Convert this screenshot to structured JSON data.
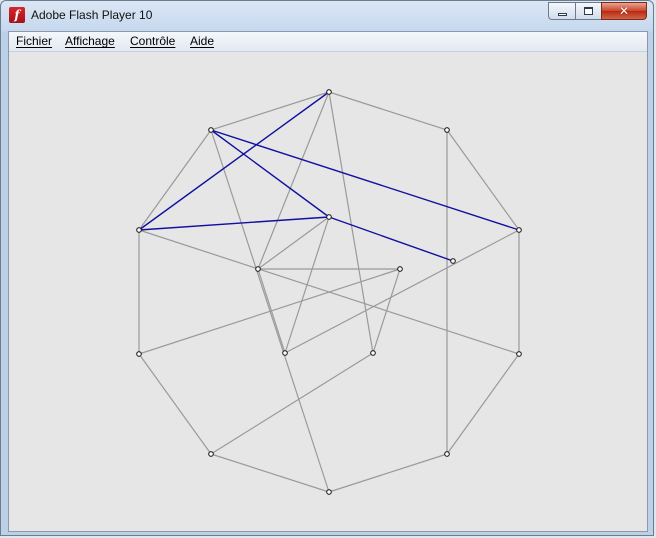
{
  "window": {
    "title": "Adobe Flash Player 10",
    "app_icon_glyph": "f",
    "close_glyph": "✕"
  },
  "menu": [
    {
      "label": "Fichier"
    },
    {
      "label": "Affichage"
    },
    {
      "label": "Contrôle"
    },
    {
      "label": "Aide"
    }
  ],
  "graph": {
    "node_count": 16,
    "edge_color": "#9a9a9a",
    "highlight_color": "#1010a0",
    "node_fill": "#ffffff",
    "node_stroke": "#222222",
    "edges": [
      [
        0,
        1
      ],
      [
        1,
        2
      ],
      [
        2,
        3
      ],
      [
        3,
        4
      ],
      [
        4,
        5
      ],
      [
        5,
        6
      ],
      [
        6,
        7
      ],
      [
        7,
        8
      ],
      [
        8,
        9
      ],
      [
        9,
        0
      ],
      [
        0,
        11
      ],
      [
        0,
        14
      ],
      [
        1,
        4
      ],
      [
        2,
        13
      ],
      [
        3,
        8
      ],
      [
        5,
        9
      ],
      [
        6,
        14
      ],
      [
        7,
        12
      ],
      [
        10,
        11
      ],
      [
        11,
        12
      ],
      [
        10,
        13
      ],
      [
        11,
        13
      ],
      [
        12,
        14
      ]
    ],
    "highlight_path": [
      2,
      9,
      10,
      8,
      0
    ]
  }
}
